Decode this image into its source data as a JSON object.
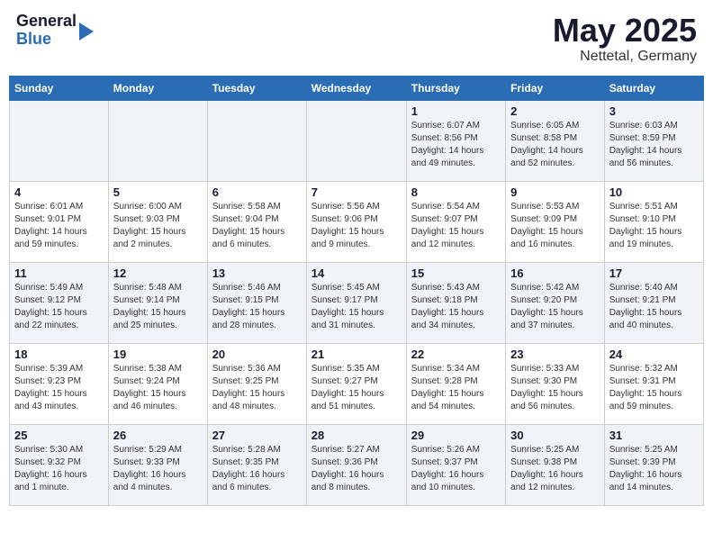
{
  "header": {
    "logo_general": "General",
    "logo_blue": "Blue",
    "month": "May 2025",
    "location": "Nettetal, Germany"
  },
  "weekdays": [
    "Sunday",
    "Monday",
    "Tuesday",
    "Wednesday",
    "Thursday",
    "Friday",
    "Saturday"
  ],
  "weeks": [
    [
      {
        "day": "",
        "detail": ""
      },
      {
        "day": "",
        "detail": ""
      },
      {
        "day": "",
        "detail": ""
      },
      {
        "day": "",
        "detail": ""
      },
      {
        "day": "1",
        "detail": "Sunrise: 6:07 AM\nSunset: 8:56 PM\nDaylight: 14 hours\nand 49 minutes."
      },
      {
        "day": "2",
        "detail": "Sunrise: 6:05 AM\nSunset: 8:58 PM\nDaylight: 14 hours\nand 52 minutes."
      },
      {
        "day": "3",
        "detail": "Sunrise: 6:03 AM\nSunset: 8:59 PM\nDaylight: 14 hours\nand 56 minutes."
      }
    ],
    [
      {
        "day": "4",
        "detail": "Sunrise: 6:01 AM\nSunset: 9:01 PM\nDaylight: 14 hours\nand 59 minutes."
      },
      {
        "day": "5",
        "detail": "Sunrise: 6:00 AM\nSunset: 9:03 PM\nDaylight: 15 hours\nand 2 minutes."
      },
      {
        "day": "6",
        "detail": "Sunrise: 5:58 AM\nSunset: 9:04 PM\nDaylight: 15 hours\nand 6 minutes."
      },
      {
        "day": "7",
        "detail": "Sunrise: 5:56 AM\nSunset: 9:06 PM\nDaylight: 15 hours\nand 9 minutes."
      },
      {
        "day": "8",
        "detail": "Sunrise: 5:54 AM\nSunset: 9:07 PM\nDaylight: 15 hours\nand 12 minutes."
      },
      {
        "day": "9",
        "detail": "Sunrise: 5:53 AM\nSunset: 9:09 PM\nDaylight: 15 hours\nand 16 minutes."
      },
      {
        "day": "10",
        "detail": "Sunrise: 5:51 AM\nSunset: 9:10 PM\nDaylight: 15 hours\nand 19 minutes."
      }
    ],
    [
      {
        "day": "11",
        "detail": "Sunrise: 5:49 AM\nSunset: 9:12 PM\nDaylight: 15 hours\nand 22 minutes."
      },
      {
        "day": "12",
        "detail": "Sunrise: 5:48 AM\nSunset: 9:14 PM\nDaylight: 15 hours\nand 25 minutes."
      },
      {
        "day": "13",
        "detail": "Sunrise: 5:46 AM\nSunset: 9:15 PM\nDaylight: 15 hours\nand 28 minutes."
      },
      {
        "day": "14",
        "detail": "Sunrise: 5:45 AM\nSunset: 9:17 PM\nDaylight: 15 hours\nand 31 minutes."
      },
      {
        "day": "15",
        "detail": "Sunrise: 5:43 AM\nSunset: 9:18 PM\nDaylight: 15 hours\nand 34 minutes."
      },
      {
        "day": "16",
        "detail": "Sunrise: 5:42 AM\nSunset: 9:20 PM\nDaylight: 15 hours\nand 37 minutes."
      },
      {
        "day": "17",
        "detail": "Sunrise: 5:40 AM\nSunset: 9:21 PM\nDaylight: 15 hours\nand 40 minutes."
      }
    ],
    [
      {
        "day": "18",
        "detail": "Sunrise: 5:39 AM\nSunset: 9:23 PM\nDaylight: 15 hours\nand 43 minutes."
      },
      {
        "day": "19",
        "detail": "Sunrise: 5:38 AM\nSunset: 9:24 PM\nDaylight: 15 hours\nand 46 minutes."
      },
      {
        "day": "20",
        "detail": "Sunrise: 5:36 AM\nSunset: 9:25 PM\nDaylight: 15 hours\nand 48 minutes."
      },
      {
        "day": "21",
        "detail": "Sunrise: 5:35 AM\nSunset: 9:27 PM\nDaylight: 15 hours\nand 51 minutes."
      },
      {
        "day": "22",
        "detail": "Sunrise: 5:34 AM\nSunset: 9:28 PM\nDaylight: 15 hours\nand 54 minutes."
      },
      {
        "day": "23",
        "detail": "Sunrise: 5:33 AM\nSunset: 9:30 PM\nDaylight: 15 hours\nand 56 minutes."
      },
      {
        "day": "24",
        "detail": "Sunrise: 5:32 AM\nSunset: 9:31 PM\nDaylight: 15 hours\nand 59 minutes."
      }
    ],
    [
      {
        "day": "25",
        "detail": "Sunrise: 5:30 AM\nSunset: 9:32 PM\nDaylight: 16 hours\nand 1 minute."
      },
      {
        "day": "26",
        "detail": "Sunrise: 5:29 AM\nSunset: 9:33 PM\nDaylight: 16 hours\nand 4 minutes."
      },
      {
        "day": "27",
        "detail": "Sunrise: 5:28 AM\nSunset: 9:35 PM\nDaylight: 16 hours\nand 6 minutes."
      },
      {
        "day": "28",
        "detail": "Sunrise: 5:27 AM\nSunset: 9:36 PM\nDaylight: 16 hours\nand 8 minutes."
      },
      {
        "day": "29",
        "detail": "Sunrise: 5:26 AM\nSunset: 9:37 PM\nDaylight: 16 hours\nand 10 minutes."
      },
      {
        "day": "30",
        "detail": "Sunrise: 5:25 AM\nSunset: 9:38 PM\nDaylight: 16 hours\nand 12 minutes."
      },
      {
        "day": "31",
        "detail": "Sunrise: 5:25 AM\nSunset: 9:39 PM\nDaylight: 16 hours\nand 14 minutes."
      }
    ]
  ]
}
